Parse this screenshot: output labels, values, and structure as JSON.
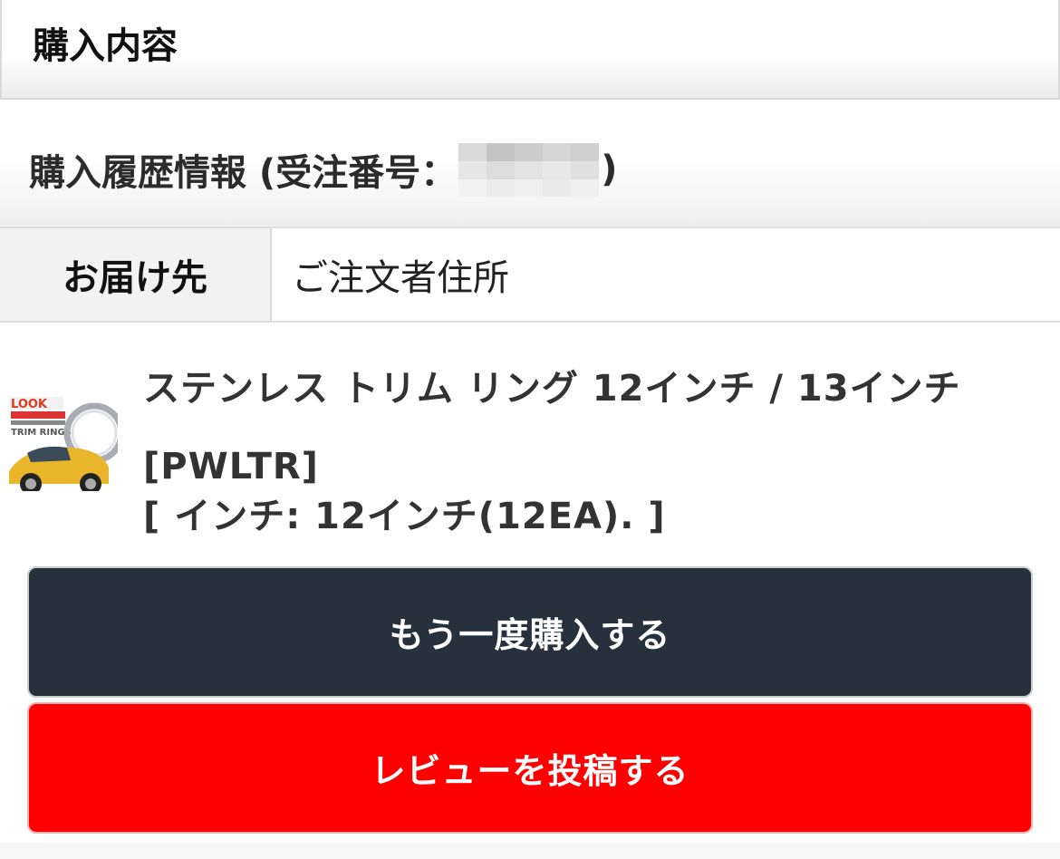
{
  "section_title": "購入内容",
  "history": {
    "prefix": "購入履歴情報 (受注番号：",
    "suffix": ")"
  },
  "delivery": {
    "label": "お届け先",
    "value": "ご注文者住所"
  },
  "product": {
    "name": "ステンレス トリム リング 12インチ / 13インチ [PWLTR]",
    "option": "[ インチ: 12インチ(12EA). ]",
    "thumbnail": {
      "brand": "LOOK",
      "caption": "TRIM RINGS"
    }
  },
  "buttons": {
    "rebuy": "もう一度購入する",
    "review": "レビューを投稿する"
  },
  "colors": {
    "rebuy_bg": "#27303d",
    "review_bg": "#ff0000"
  }
}
